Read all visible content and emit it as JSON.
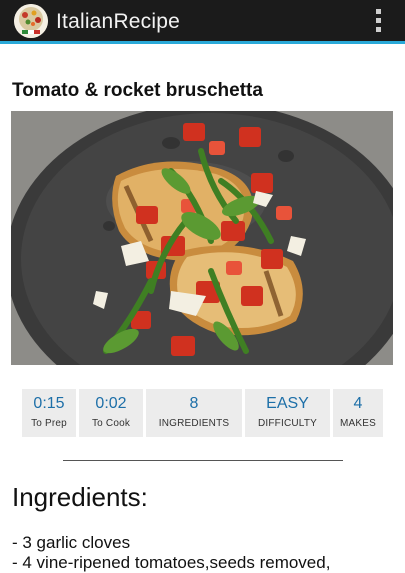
{
  "app": {
    "title": "ItalianRecipe",
    "icon": "app-logo-icon",
    "menu_icon": "overflow-menu-icon",
    "accent_color": "#2aa9d8",
    "bar_color": "#1b1b1b"
  },
  "recipe": {
    "title": "Tomato & rocket bruschetta",
    "photo_icon": "bruschetta-photo"
  },
  "stats": [
    {
      "value": "0:15",
      "label": "To Prep"
    },
    {
      "value": "0:02",
      "label": "To Cook"
    },
    {
      "value": "8",
      "label": "INGREDIENTS"
    },
    {
      "value": "EASY",
      "label": "DIFFICULTY"
    },
    {
      "value": "4",
      "label": "MAKES"
    }
  ],
  "ingredients": {
    "heading": "Ingredients:",
    "items": [
      "- 3 garlic cloves",
      "- 4 vine-ripened tomatoes,seeds removed,"
    ]
  }
}
